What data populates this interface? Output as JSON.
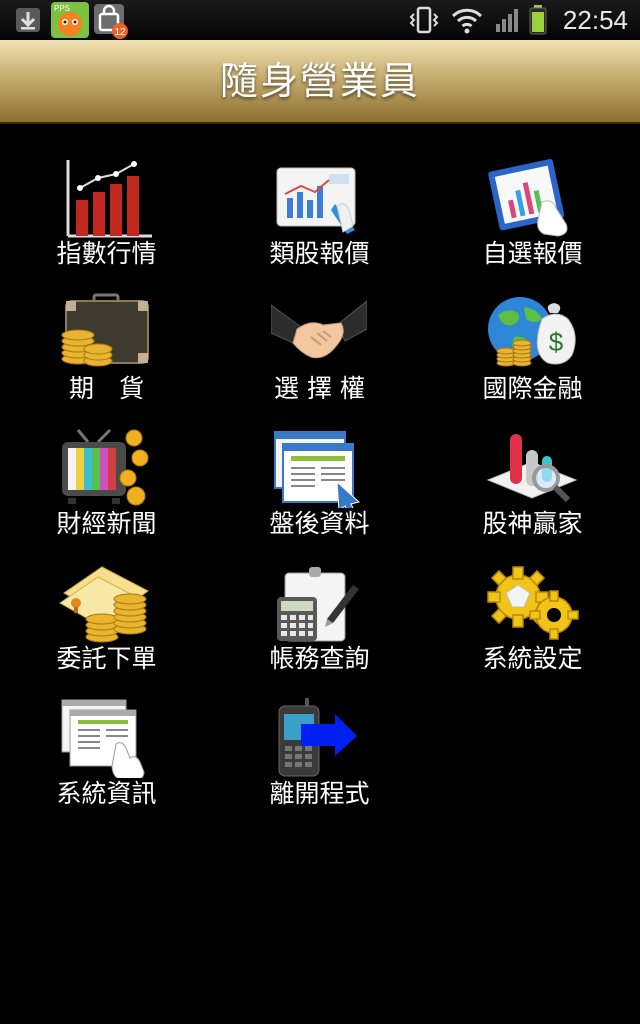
{
  "status_bar": {
    "time": "22:54",
    "app_notification_text": "PPS",
    "badge_count": "12",
    "icons": [
      "download-icon",
      "pps-app-icon",
      "shopping-bag-icon",
      "vibrate-icon",
      "wifi-icon",
      "signal-icon",
      "battery-icon"
    ]
  },
  "header": {
    "title": "隨身營業員"
  },
  "menu": [
    {
      "label": "指數行情",
      "icon": "index-chart-icon"
    },
    {
      "label": "類股報價",
      "icon": "sector-quote-icon"
    },
    {
      "label": "自選報價",
      "icon": "custom-quote-icon"
    },
    {
      "label": "期　貨",
      "icon": "futures-icon"
    },
    {
      "label": "選 擇 權",
      "icon": "options-handshake-icon"
    },
    {
      "label": "國際金融",
      "icon": "globe-finance-icon"
    },
    {
      "label": "財經新聞",
      "icon": "tv-news-icon"
    },
    {
      "label": "盤後資料",
      "icon": "after-hours-data-icon"
    },
    {
      "label": "股神贏家",
      "icon": "analysis-magnifier-icon"
    },
    {
      "label": "委託下單",
      "icon": "order-coins-icon"
    },
    {
      "label": "帳務查詢",
      "icon": "account-calculator-icon"
    },
    {
      "label": "系統設定",
      "icon": "gear-icon"
    },
    {
      "label": "系統資訊",
      "icon": "system-info-icon"
    },
    {
      "label": "離開程式",
      "icon": "exit-phone-icon"
    }
  ],
  "colors": {
    "header_gold": "#c6ad70",
    "background": "#000000",
    "label_text": "#ffffff"
  }
}
